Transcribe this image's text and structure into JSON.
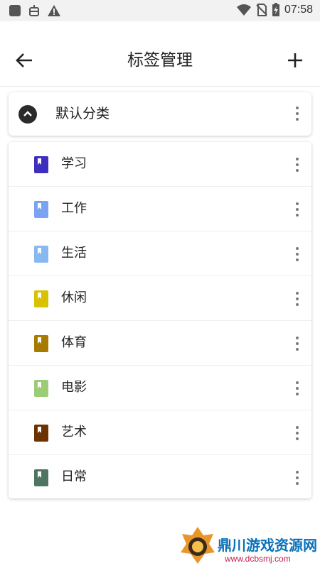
{
  "status_bar": {
    "time": "07:58",
    "left_icons": [
      "app-square-icon",
      "bug-icon",
      "warning-icon"
    ],
    "right_icons": [
      "wifi-icon",
      "no-sim-icon",
      "battery-charging-icon"
    ]
  },
  "app_bar": {
    "title": "标签管理",
    "back_icon": "arrow-back-icon",
    "add_icon": "plus-icon"
  },
  "category": {
    "title": "默认分类",
    "expanded": true
  },
  "tags": [
    {
      "label": "学习",
      "color": "#3f2fbf"
    },
    {
      "label": "工作",
      "color": "#7aa3f4"
    },
    {
      "label": "生活",
      "color": "#88b8f2"
    },
    {
      "label": "休闲",
      "color": "#d8c200"
    },
    {
      "label": "体育",
      "color": "#a67b00"
    },
    {
      "label": "电影",
      "color": "#9ccc74"
    },
    {
      "label": "艺术",
      "color": "#6b3300"
    },
    {
      "label": "日常",
      "color": "#4e7561"
    }
  ],
  "watermark": {
    "text": "鼎川游戏资源网",
    "url": "www.dcbsmj.com"
  }
}
